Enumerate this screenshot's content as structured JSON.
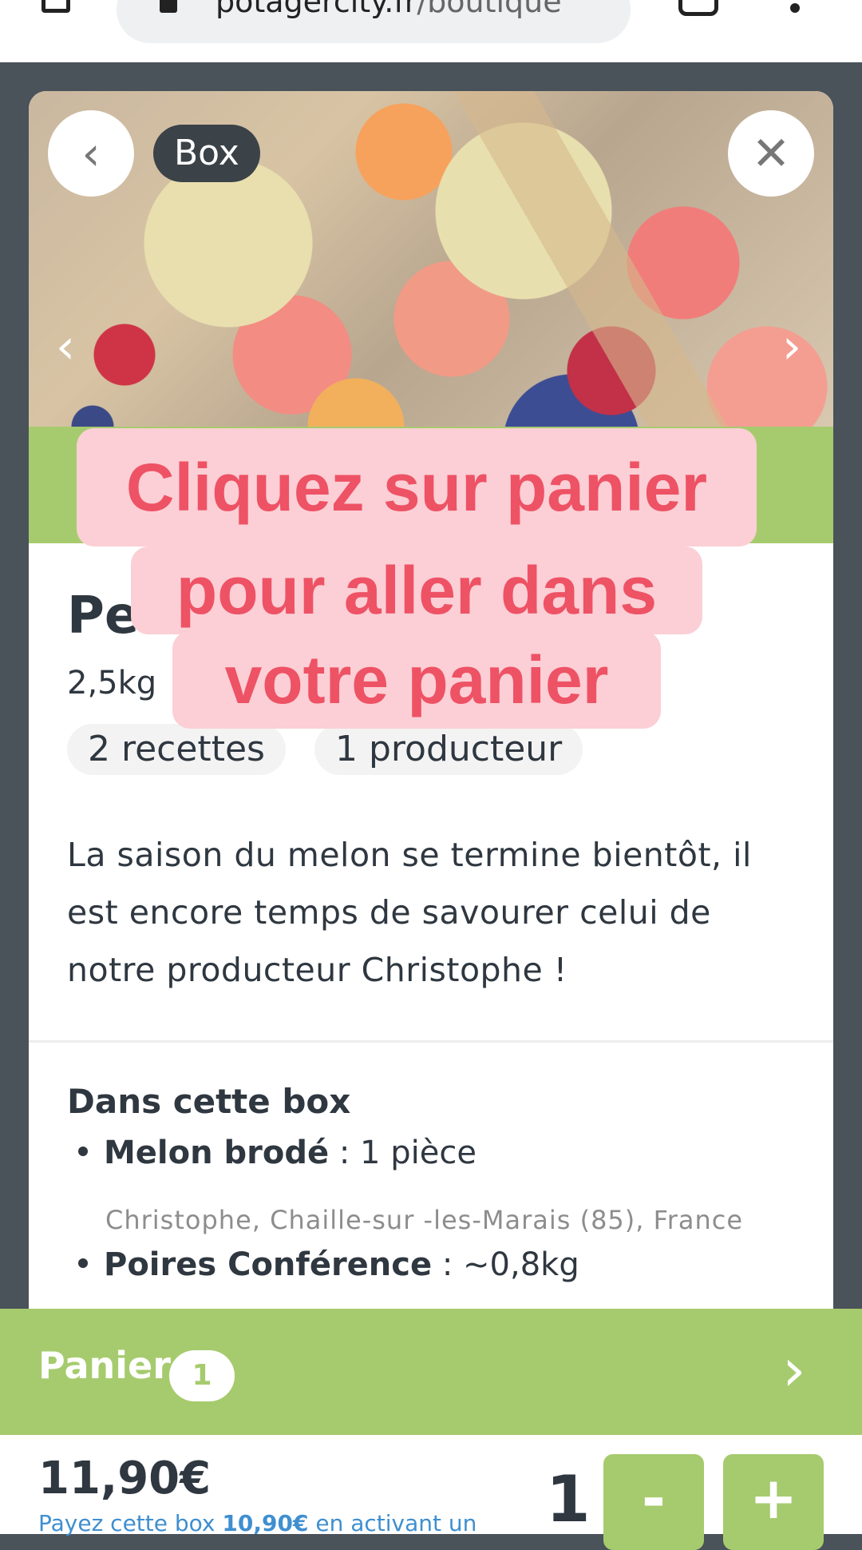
{
  "browser": {
    "url_domain": "potagercity.fr",
    "url_path": "/boutique"
  },
  "modal": {
    "badge": "Box",
    "back_icon": "chevron-left-icon",
    "close_icon": "close-icon",
    "product_title": "Pe",
    "weight": "2,5kg",
    "chips": [
      "2 recettes",
      "1 producteur"
    ],
    "description": "La saison du melon se termine bientôt, il est encore temps de savourer celui de notre producteur Christophe !",
    "section_title": "Dans cette box",
    "items": [
      {
        "name": "Melon brodé",
        "qty": " : 1 pièce",
        "origin": "Christophe, Chaille-sur -les-Marais (85), France"
      },
      {
        "name": "Poires Conférence",
        "qty": " : ~0,8kg"
      }
    ]
  },
  "overlay": {
    "lines": [
      "Cliquez sur panier",
      "pour aller dans",
      "votre panier"
    ]
  },
  "cart": {
    "label": "Panier",
    "count": "1"
  },
  "footer": {
    "price": "11,90€",
    "offer_prefix": "Payez cette box ",
    "offer_price": "10,90€",
    "offer_suffix": " en activant un",
    "quantity": "1",
    "minus_label": "-",
    "plus_label": "+"
  },
  "colors": {
    "accent_green": "#a6cb6e",
    "overlay_bg": "#fbcfd5",
    "overlay_text": "#ee5265",
    "dark_text": "#2f3740",
    "link_blue": "#3f8fd0"
  }
}
